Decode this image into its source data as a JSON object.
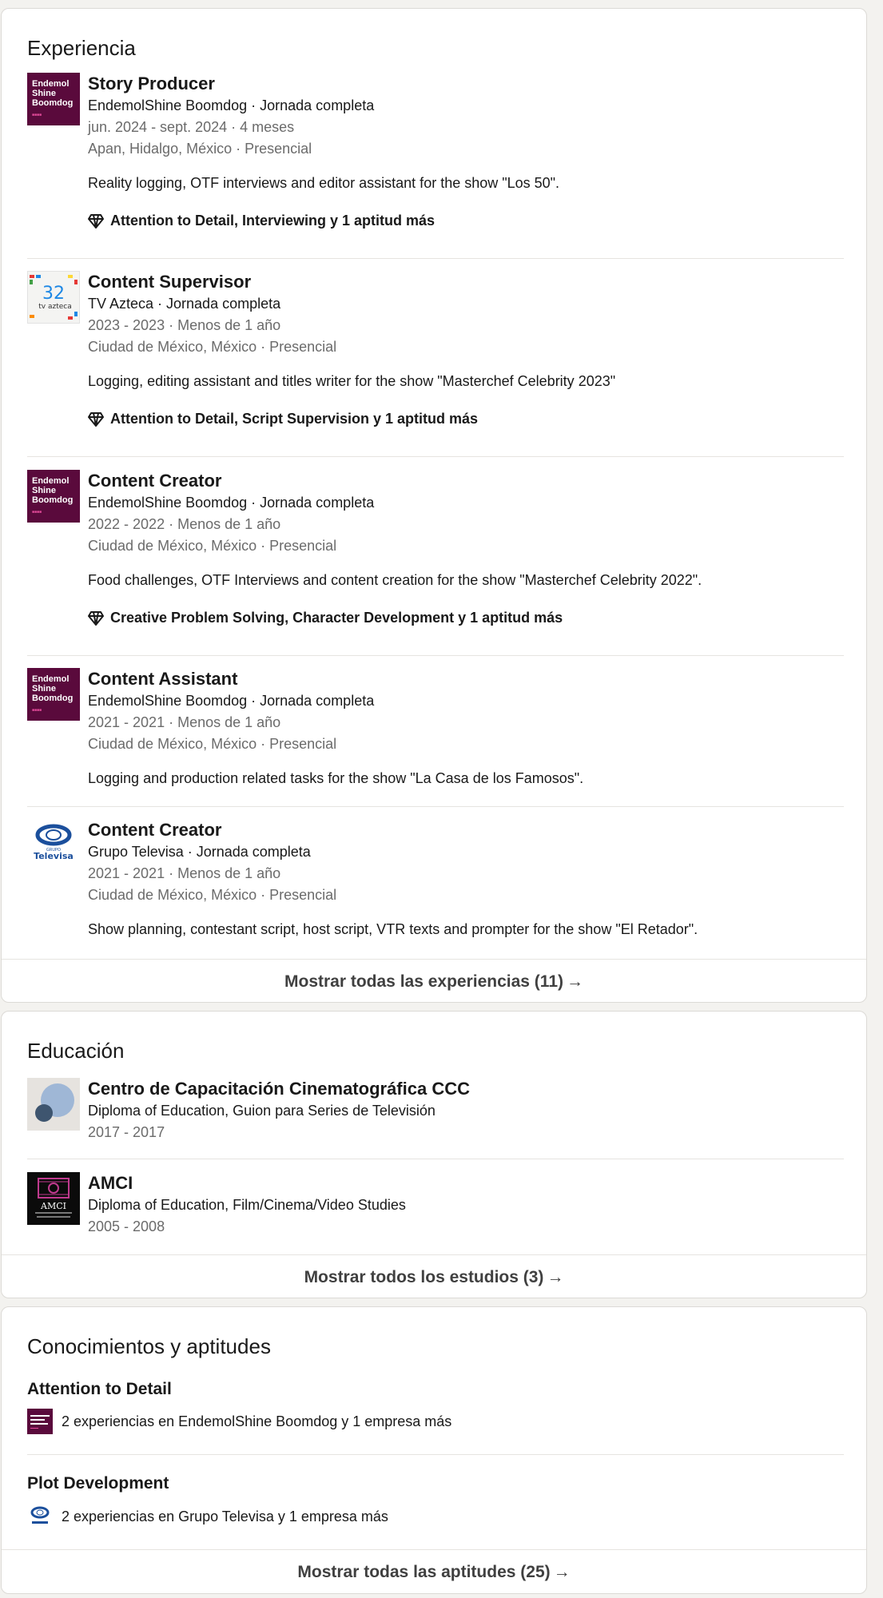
{
  "experience": {
    "title": "Experiencia",
    "items": [
      {
        "role": "Story Producer",
        "company": "EndemolShine Boomdog · Jornada completa",
        "dates": "jun. 2024 - sept. 2024 · 4 meses",
        "location": "Apan, Hidalgo, México · Presencial",
        "description": "Reality logging, OTF interviews and editor assistant for the show \"Los 50\".",
        "skills": "Attention to Detail, Interviewing y 1 aptitud más",
        "logo": "endemol-logo",
        "logo_text": [
          "Endemol",
          "Shine",
          "Boomdog"
        ]
      },
      {
        "role": "Content Supervisor",
        "company": "TV Azteca · Jornada completa",
        "dates": "2023 - 2023 · Menos de 1 año",
        "location": "Ciudad de México, México · Presencial",
        "description": "Logging, editing assistant and titles writer for the show \"Masterchef Celebrity 2023\"",
        "skills": "Attention to Detail, Script Supervision y 1 aptitud más",
        "logo": "tv-azteca-logo",
        "logo_text": [
          "32",
          "tv azteca"
        ]
      },
      {
        "role": "Content Creator",
        "company": "EndemolShine Boomdog · Jornada completa",
        "dates": "2022 - 2022 · Menos de 1 año",
        "location": "Ciudad de México, México · Presencial",
        "description": "Food challenges, OTF Interviews and content creation for the show \"Masterchef Celebrity 2022\".",
        "skills": "Creative Problem Solving, Character Development y 1 aptitud más",
        "logo": "endemol-logo",
        "logo_text": [
          "Endemol",
          "Shine",
          "Boomdog"
        ]
      },
      {
        "role": "Content Assistant",
        "company": "EndemolShine Boomdog · Jornada completa",
        "dates": "2021 - 2021 · Menos de 1 año",
        "location": "Ciudad de México, México · Presencial",
        "description": "Logging and production related tasks for the show \"La Casa de los Famosos\".",
        "logo": "endemol-logo",
        "logo_text": [
          "Endemol",
          "Shine",
          "Boomdog"
        ]
      },
      {
        "role": "Content Creator",
        "company": "Grupo Televisa · Jornada completa",
        "dates": "2021 - 2021 · Menos de 1 año",
        "location": "Ciudad de México, México · Presencial",
        "description": "Show planning, contestant script, host script, VTR texts and prompter for the show \"El Retador\".",
        "logo": "televisa-logo",
        "logo_text": [
          "GRUPO",
          "Televisa"
        ]
      }
    ],
    "show_all": "Mostrar todas las experiencias (11)"
  },
  "education": {
    "title": "Educación",
    "items": [
      {
        "school": "Centro de Capacitación Cinematográfica CCC",
        "degree": "Diploma of Education, Guion para Series de Televisión",
        "dates": "2017 - 2017",
        "logo": "ccc-logo"
      },
      {
        "school": "AMCI",
        "degree": "Diploma of Education, Film/Cinema/Video Studies",
        "dates": "2005 - 2008",
        "logo": "amci-logo",
        "logo_text": "AMCI"
      }
    ],
    "show_all": "Mostrar todos los estudios (3)"
  },
  "skills": {
    "title": "Conocimientos y aptitudes",
    "items": [
      {
        "name": "Attention to Detail",
        "detail": "2 experiencias en EndemolShine Boomdog y 1 empresa más",
        "logo": "endemol-logo"
      },
      {
        "name": "Plot Development",
        "detail": "2 experiencias en Grupo Televisa y 1 empresa más",
        "logo": "televisa-logo"
      }
    ],
    "show_all": "Mostrar todas las aptitudes (25)"
  },
  "icons": {
    "arrow": "→",
    "skills": "diamond-outline-icon"
  },
  "colors": {
    "endemol_bg": "#5a0a3c",
    "televisa_blue": "#1b4f9c",
    "muted_text": "#6b6b6b"
  }
}
